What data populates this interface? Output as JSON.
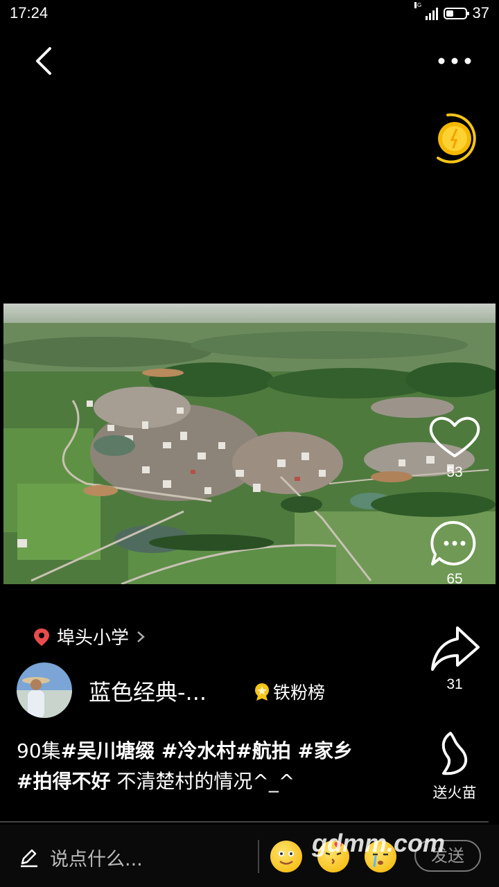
{
  "status_bar": {
    "time": "17:24",
    "network": "4G",
    "battery": "37"
  },
  "post": {
    "location": "埠头小学",
    "username": "蓝色经典-...",
    "fan_rank_label": "铁粉榜",
    "caption_segments": [
      {
        "text": "90集",
        "bold": false
      },
      {
        "text": "#吴川塘缀 #冷水村#航拍 #家乡",
        "bold": true
      },
      {
        "text": "#拍得不好",
        "bold": true
      },
      {
        "text": " 不清楚村的情况^_^",
        "bold": false
      }
    ]
  },
  "actions": {
    "like_count": "53",
    "comment_count": "65",
    "share_count": "31",
    "gift_label": "送火苗"
  },
  "comment_bar": {
    "placeholder": "说点什么...",
    "send_label": "发送",
    "emojis": [
      "smile-emoji",
      "kiss-emoji",
      "cry-emoji"
    ]
  },
  "watermark": "gdmm.com",
  "colors": {
    "coin": "#f5c518",
    "location_pin": "#e84b4b",
    "background": "#000000"
  }
}
